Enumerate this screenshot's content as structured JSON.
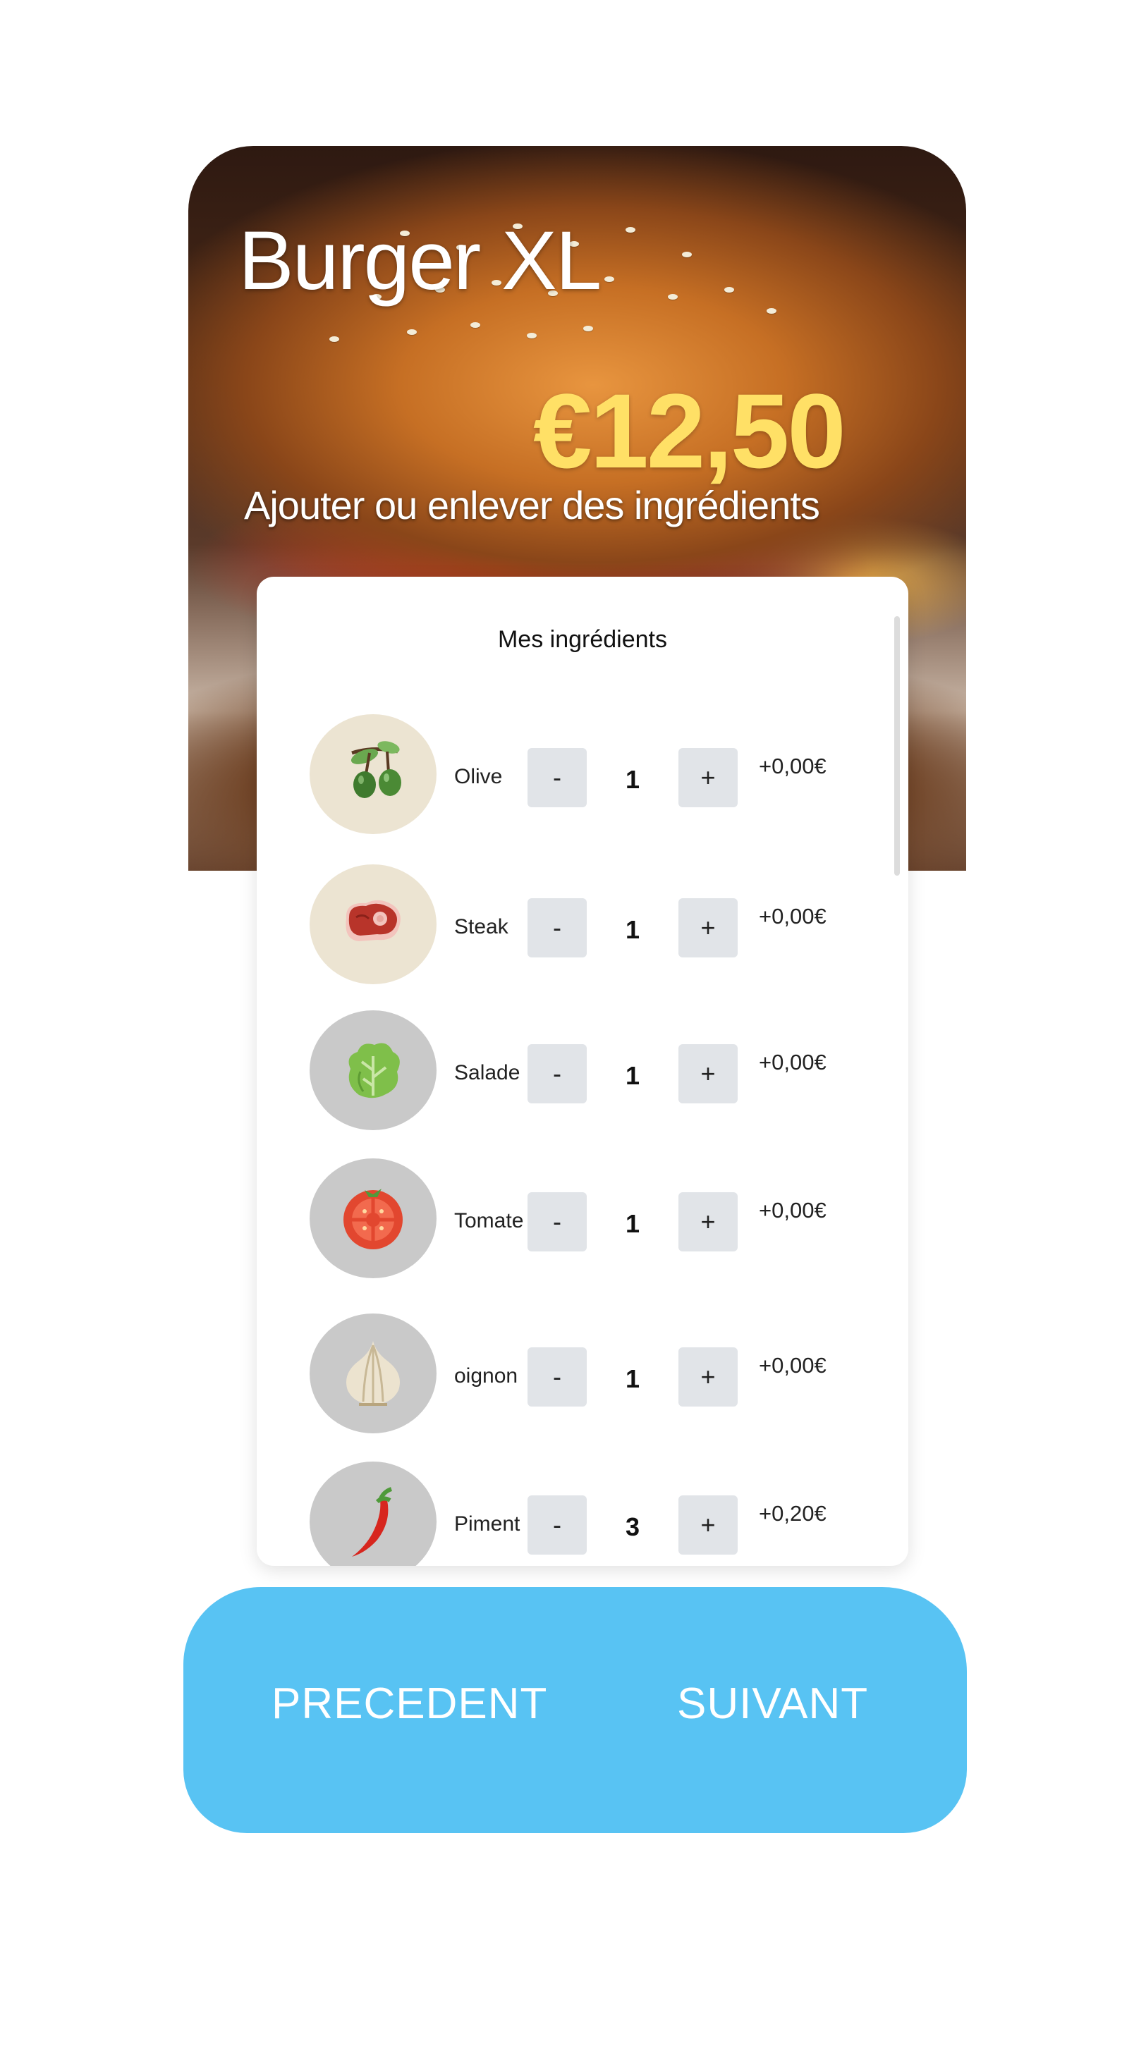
{
  "product": {
    "name": "Burger XL",
    "price": "€12,50",
    "subtitle": "Ajouter ou enlever des ingrédients"
  },
  "ingredients_panel": {
    "title": "Mes ingrédients",
    "minus_label": "-",
    "plus_label": "+",
    "items": [
      {
        "name": "Olive",
        "icon": "olive-icon",
        "quantity": "1",
        "extra": "+0,00€"
      },
      {
        "name": "Steak",
        "icon": "steak-icon",
        "quantity": "1",
        "extra": "+0,00€"
      },
      {
        "name": "Salade",
        "icon": "lettuce-icon",
        "quantity": "1",
        "extra": "+0,00€"
      },
      {
        "name": "Tomate",
        "icon": "tomato-icon",
        "quantity": "1",
        "extra": "+0,00€"
      },
      {
        "name": "oignon",
        "icon": "onion-icon",
        "quantity": "1",
        "extra": "+0,00€"
      },
      {
        "name": "Piment",
        "icon": "chili-icon",
        "quantity": "3",
        "extra": "+0,20€"
      }
    ]
  },
  "navigation": {
    "previous_label": "PRECEDENT",
    "next_label": "SUIVANT"
  },
  "colors": {
    "accent_blue": "#58c3f3",
    "price_yellow": "#ffe066",
    "button_grey": "#e1e4e8"
  }
}
